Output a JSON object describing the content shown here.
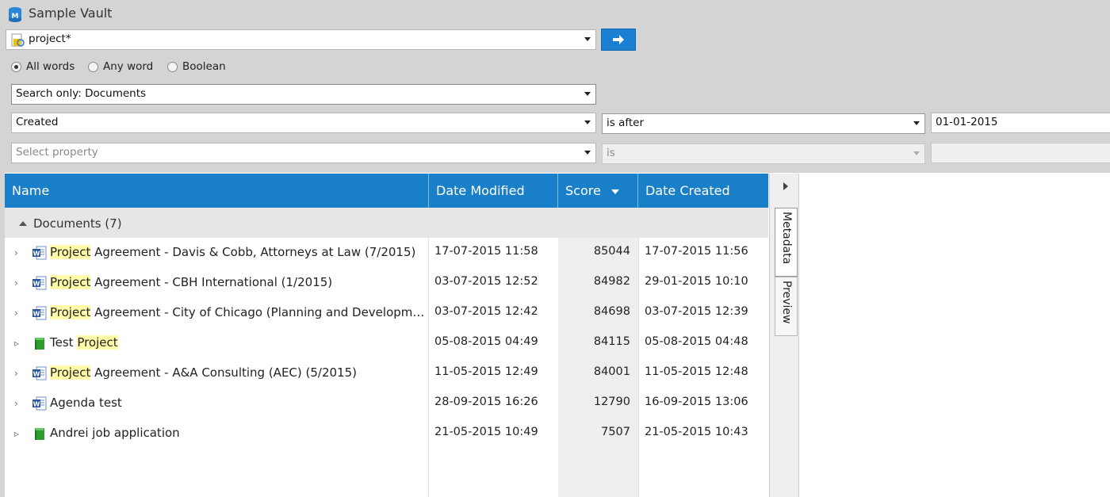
{
  "window": {
    "title": "Sample Vault"
  },
  "search": {
    "query": "project*",
    "go_button_icon": "arrow-right-icon"
  },
  "search_mode": {
    "options": [
      "All words",
      "Any word",
      "Boolean"
    ],
    "selected": "All words"
  },
  "search_only": {
    "value": "Search only: Documents"
  },
  "filters": [
    {
      "property": "Created",
      "operator": "is after",
      "value": "01-01-2015"
    },
    {
      "property": "Select property",
      "operator": "is",
      "value": ""
    }
  ],
  "table": {
    "columns": [
      "Name",
      "Date Modified",
      "Score",
      "Date Created"
    ],
    "sort_column": "Score",
    "sort_direction": "descending",
    "group": {
      "label": "Documents (7)"
    },
    "rows": [
      {
        "icon": "word-document-icon",
        "expand": "›",
        "highlight": "Project",
        "rest": " Agreement - Davis & Cobb, Attorneys at Law (7/2015)",
        "modified": "17-07-2015 11:58",
        "score": "85044",
        "created": "17-07-2015 11:56"
      },
      {
        "icon": "word-document-icon",
        "expand": "›",
        "highlight": "Project",
        "rest": " Agreement - CBH International (1/2015)",
        "modified": "03-07-2015 12:52",
        "score": "84982",
        "created": "29-01-2015 10:10"
      },
      {
        "icon": "word-document-icon",
        "expand": "›",
        "highlight": "Project",
        "rest": " Agreement - City of Chicago (Planning and Development)",
        "modified": "03-07-2015 12:42",
        "score": "84698",
        "created": "03-07-2015 12:39"
      },
      {
        "icon": "document-collection-icon",
        "expand": "▹",
        "prefix": "Test ",
        "highlight": "Project",
        "rest": "",
        "modified": "05-08-2015 04:49",
        "score": "84115",
        "created": "05-08-2015 04:48"
      },
      {
        "icon": "word-document-icon",
        "expand": "›",
        "highlight": "Project",
        "rest": " Agreement - A&A Consulting (AEC) (5/2015)",
        "modified": "11-05-2015 12:49",
        "score": "84001",
        "created": "11-05-2015 12:48"
      },
      {
        "icon": "word-document-icon",
        "expand": "›",
        "prefix": "Agenda test",
        "highlight": "",
        "rest": "",
        "modified": "28-09-2015 16:26",
        "score": "12790",
        "created": "16-09-2015 13:06"
      },
      {
        "icon": "document-collection-icon",
        "expand": "▹",
        "prefix": "Andrei job application",
        "highlight": "",
        "rest": "",
        "modified": "21-05-2015 10:49",
        "score": "7507",
        "created": "21-05-2015 10:43"
      }
    ]
  },
  "side_tabs": [
    "Metadata",
    "Preview"
  ],
  "colors": {
    "header_blue": "#1a7fc9",
    "highlight": "#fffba8",
    "go_button": "#1a7fd0"
  }
}
